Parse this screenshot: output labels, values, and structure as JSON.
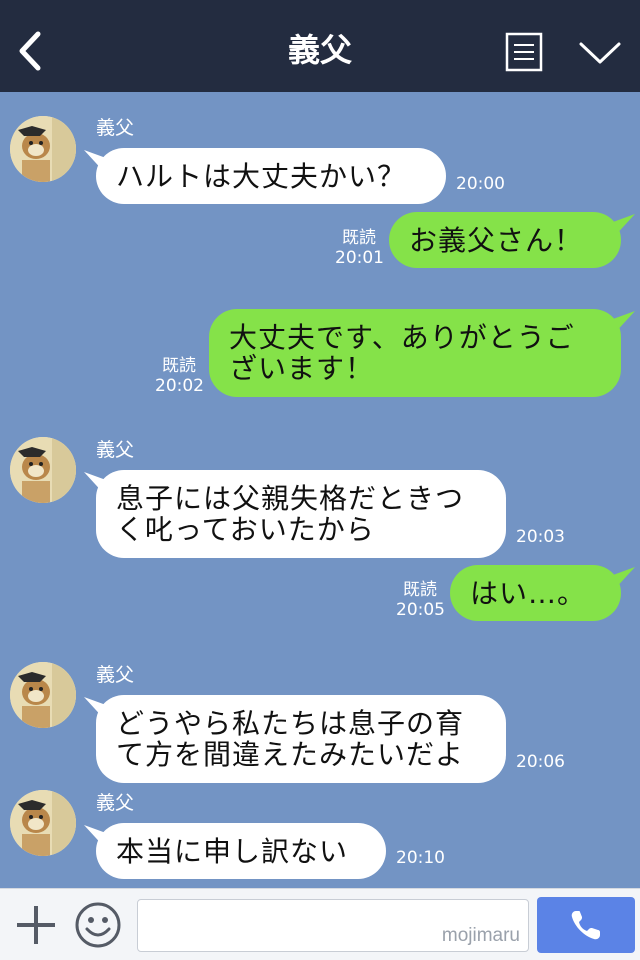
{
  "header": {
    "title": "義父",
    "back_icon": "chevron-left-icon",
    "menu_icon": "document-icon",
    "collapse_icon": "chevron-down-icon",
    "background": "#232c40"
  },
  "chat": {
    "background": "#7394c4",
    "incoming_bubble_color": "#ffffff",
    "outgoing_bubble_color": "#85e249",
    "messages": [
      {
        "direction": "incoming",
        "sender": "義父",
        "lines": [
          "ハルトは大丈夫かい？"
        ],
        "time": "20:00"
      },
      {
        "direction": "outgoing",
        "read": "既読",
        "lines": [
          "お義父さん！"
        ],
        "time": "20:01"
      },
      {
        "direction": "outgoing",
        "read": "既読",
        "lines": [
          "大丈夫です、ありがとうご",
          "ざいます！"
        ],
        "time": "20:02"
      },
      {
        "direction": "incoming",
        "sender": "義父",
        "lines": [
          "息子には父親失格だときつ",
          "く叱っておいたから"
        ],
        "time": "20:03"
      },
      {
        "direction": "outgoing",
        "read": "既読",
        "lines": [
          "はい…。"
        ],
        "time": "20:05"
      },
      {
        "direction": "incoming",
        "sender": "義父",
        "lines": [
          "どうやら私たちは息子の育",
          "て方を間違えたみたいだよ"
        ],
        "time": "20:06"
      },
      {
        "direction": "incoming",
        "sender": "義父",
        "lines": [
          "本当に申し訳ない"
        ],
        "time": "20:10"
      }
    ]
  },
  "footer": {
    "plus_icon": "plus-icon",
    "emoji_icon": "smiley-icon",
    "input_value": "",
    "watermark": "mojimaru",
    "call_icon": "phone-icon",
    "call_button_color": "#5b83e6"
  }
}
